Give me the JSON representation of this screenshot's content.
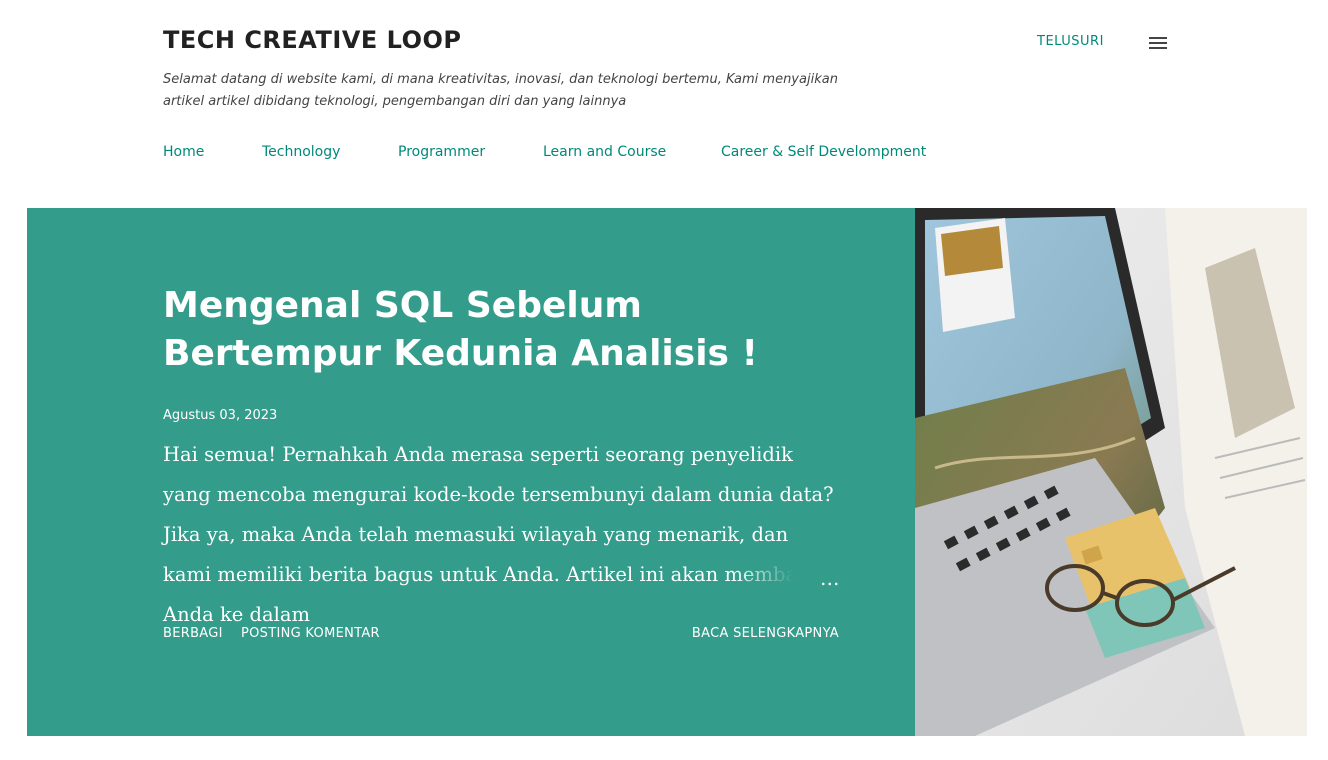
{
  "header": {
    "site_title": "TECH CREATIVE LOOP",
    "description": "Selamat datang di website kami, di mana kreativitas, inovasi, dan teknologi bertemu, Kami menyajikan artikel artikel dibidang teknologi, pengembangan diri dan yang lainnya",
    "search_label": "TELUSURI",
    "menu_icon": "menu-icon"
  },
  "nav": {
    "items": [
      "Home",
      "Technology",
      "Programmer",
      "Learn and Course",
      "Career & Self Develompment"
    ]
  },
  "post": {
    "title": "Mengenal SQL Sebelum Bertempur Kedunia Analisis !",
    "date": "Agustus 03, 2023",
    "snippet": "Hai semua! Pernahkah Anda merasa seperti seorang penyelidik yang mencoba mengurai kode-kode tersembunyi dalam dunia data? Jika ya, maka Anda telah memasuki wilayah yang menarik, dan kami memiliki berita bagus untuk Anda. Artikel ini akan membawa Anda ke dalam",
    "ellipsis": "…",
    "share_label": "BERBAGI",
    "comment_label": "POSTING KOMENTAR",
    "readmore_label": "BACA SELENGKAPNYA",
    "card_color": "#349c8b"
  },
  "colors": {
    "accent": "#00897b",
    "text": "#212121"
  }
}
